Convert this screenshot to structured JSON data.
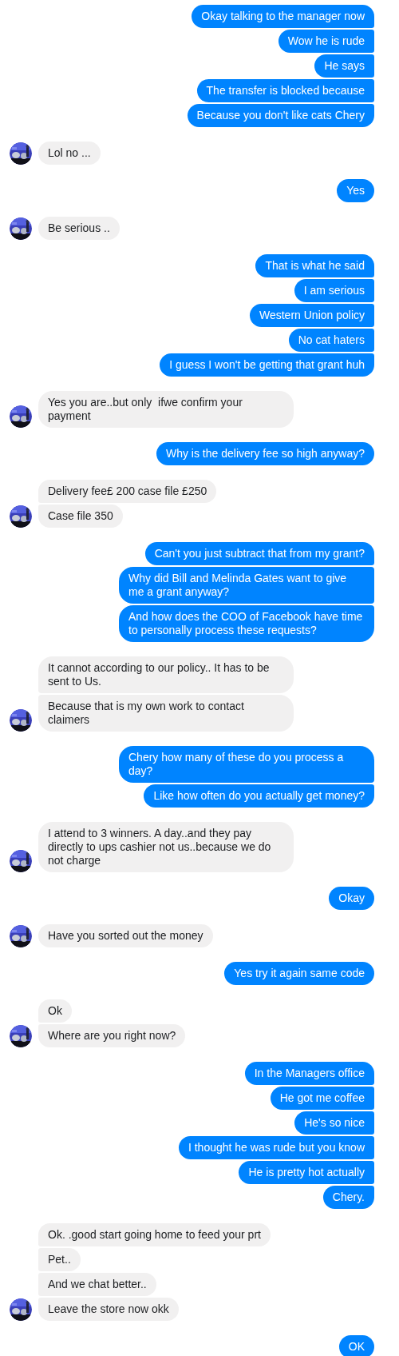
{
  "groups": [
    {
      "kind": "outgoing",
      "messages": [
        "Okay talking to the manager now",
        "Wow he is rude",
        "He says",
        "The transfer is blocked because",
        "Because you don't like cats Chery"
      ]
    },
    {
      "kind": "incoming",
      "messages": [
        "Lol no ..."
      ]
    },
    {
      "kind": "outgoing",
      "messages": [
        "Yes"
      ]
    },
    {
      "kind": "incoming",
      "messages": [
        "Be serious .."
      ]
    },
    {
      "kind": "outgoing",
      "messages": [
        "That is what he said",
        "I am serious",
        "Western Union policy",
        "No cat haters",
        "I guess I won't be getting that grant huh"
      ]
    },
    {
      "kind": "incoming",
      "messages": [
        "Yes you are..but only  ifwe confirm your payment"
      ]
    },
    {
      "kind": "outgoing",
      "messages": [
        "Why is the delivery fee so high anyway?"
      ]
    },
    {
      "kind": "incoming",
      "messages": [
        "Delivery fee£ 200 case file £250",
        "Case file 350"
      ]
    },
    {
      "kind": "outgoing",
      "messages": [
        "Can't you just subtract that from my grant?",
        "Why did Bill and Melinda Gates want to give me a grant anyway?",
        "And how does the COO of Facebook have time to personally process these requests?"
      ]
    },
    {
      "kind": "incoming",
      "messages": [
        "It cannot according to our policy.. It has to be sent to Us.",
        "Because that is my own work to contact claimers"
      ]
    },
    {
      "kind": "outgoing",
      "messages": [
        "Chery how many of these do you process a day?",
        "Like how often do you actually get money?"
      ]
    },
    {
      "kind": "incoming",
      "messages": [
        "I attend to 3 winners. A day..and they pay directly to ups cashier not us..because we do not charge"
      ]
    },
    {
      "kind": "outgoing",
      "messages": [
        "Okay"
      ]
    },
    {
      "kind": "incoming",
      "messages": [
        "Have you sorted out the money"
      ]
    },
    {
      "kind": "outgoing",
      "messages": [
        "Yes try it again same code"
      ]
    },
    {
      "kind": "incoming",
      "messages": [
        "Ok",
        "Where are you right now?"
      ]
    },
    {
      "kind": "outgoing",
      "messages": [
        "In the Managers office",
        "He got me coffee",
        "He's so nice",
        "I thought he was rude but you know",
        "He is pretty hot actually",
        "Chery."
      ]
    },
    {
      "kind": "incoming",
      "messages": [
        "Ok. .good start going home to feed your prt",
        "Pet..",
        "And we chat better..",
        "Leave the store now okk"
      ]
    },
    {
      "kind": "outgoing",
      "messages": [
        "OK"
      ]
    }
  ]
}
